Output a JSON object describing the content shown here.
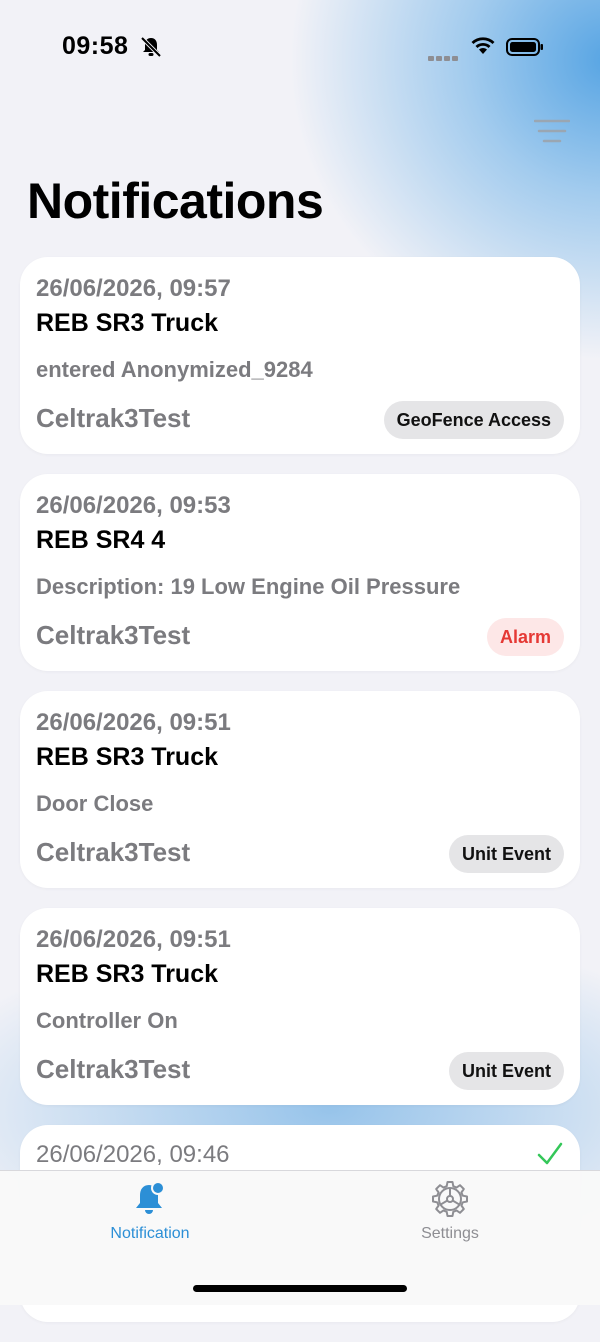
{
  "status_bar": {
    "time": "09:58"
  },
  "header": {
    "title": "Notifications"
  },
  "notifications": [
    {
      "date": "26/06/2026, 09:57",
      "unit": "REB SR3 Truck",
      "description": "entered Anonymized_9284",
      "account": "Celtrak3Test",
      "type": "GeoFence Access"
    },
    {
      "date": "26/06/2026, 09:53",
      "unit": "REB SR4 4",
      "description": "Description: 19 Low Engine Oil Pressure",
      "account": "Celtrak3Test",
      "type": "Alarm"
    },
    {
      "date": "26/06/2026, 09:51",
      "unit": "REB SR3 Truck",
      "description": "Door Close",
      "account": "Celtrak3Test",
      "type": "Unit Event"
    },
    {
      "date": "26/06/2026, 09:51",
      "unit": "REB SR3 Truck",
      "description": "Controller On",
      "account": "Celtrak3Test",
      "type": "Unit Event"
    },
    {
      "date": "26/06/2026, 09:46"
    }
  ],
  "tab_bar": {
    "tabs": [
      {
        "label": "Notification",
        "icon": "bell-badge-icon",
        "active": true
      },
      {
        "label": "Settings",
        "icon": "gear-icon",
        "active": false
      }
    ]
  },
  "colors": {
    "accent": "#2c8fd6",
    "alarm": "#e53935",
    "check": "#34c759"
  }
}
